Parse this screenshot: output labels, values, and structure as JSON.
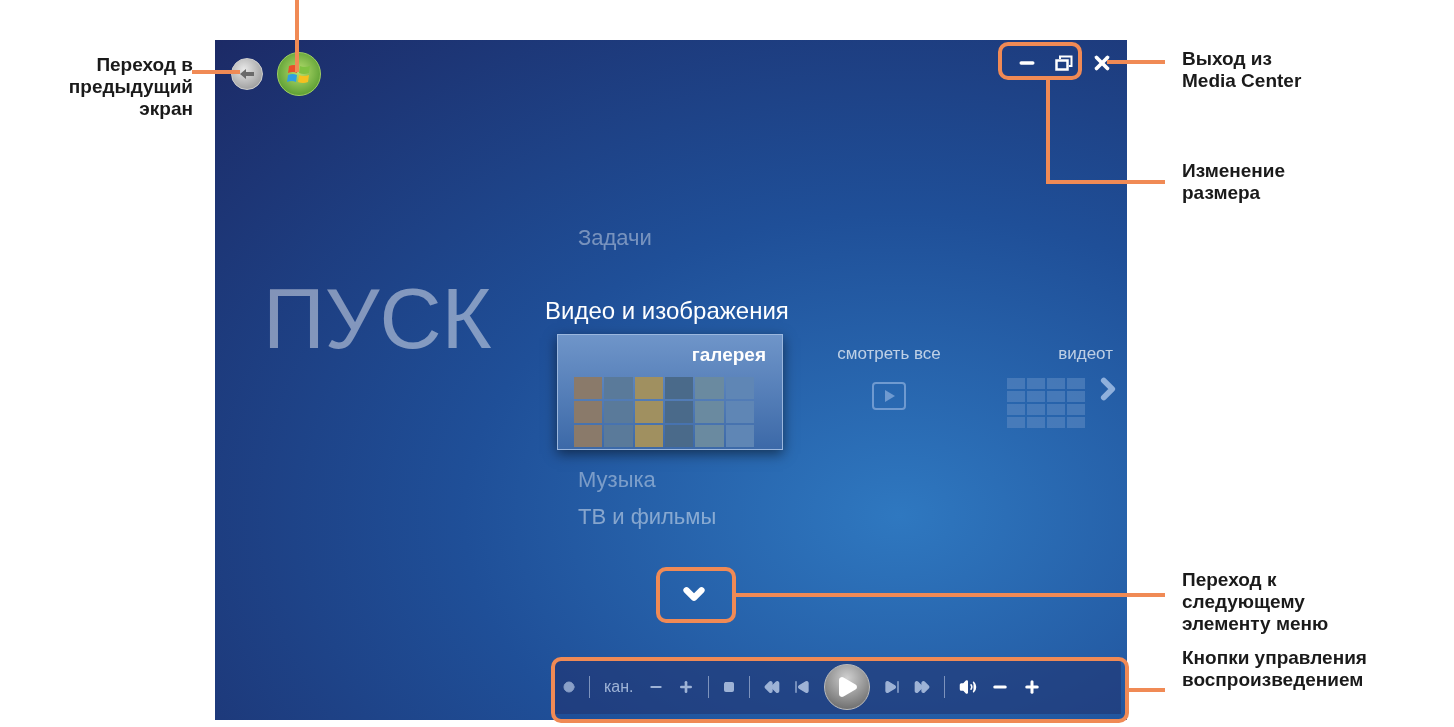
{
  "screen": {
    "background_title": "ПУСК",
    "menu": [
      {
        "label": "Задачи",
        "selected": false
      },
      {
        "label": "Видео и изображения",
        "selected": true,
        "tiles": [
          {
            "kind": "gallery",
            "label": "галерея",
            "selected": true
          },
          {
            "kind": "play",
            "label": "смотреть все",
            "selected": false
          },
          {
            "kind": "grid",
            "label": "видеот",
            "selected": false
          }
        ]
      },
      {
        "label": "Музыка",
        "selected": false
      },
      {
        "label": "ТВ и фильмы",
        "selected": false
      }
    ],
    "playback_bar": {
      "channel_label": "кан."
    }
  },
  "callouts": {
    "left": [
      {
        "text": "Переход в\nпредыдущий\nэкран"
      }
    ],
    "right": [
      {
        "text": "Выход из\nMedia Center"
      },
      {
        "text": "Изменение\nразмера"
      },
      {
        "text": "Переход к\nследующему\nэлементу меню"
      },
      {
        "text": "Кнопки управления\nвоспроизведением"
      }
    ]
  }
}
